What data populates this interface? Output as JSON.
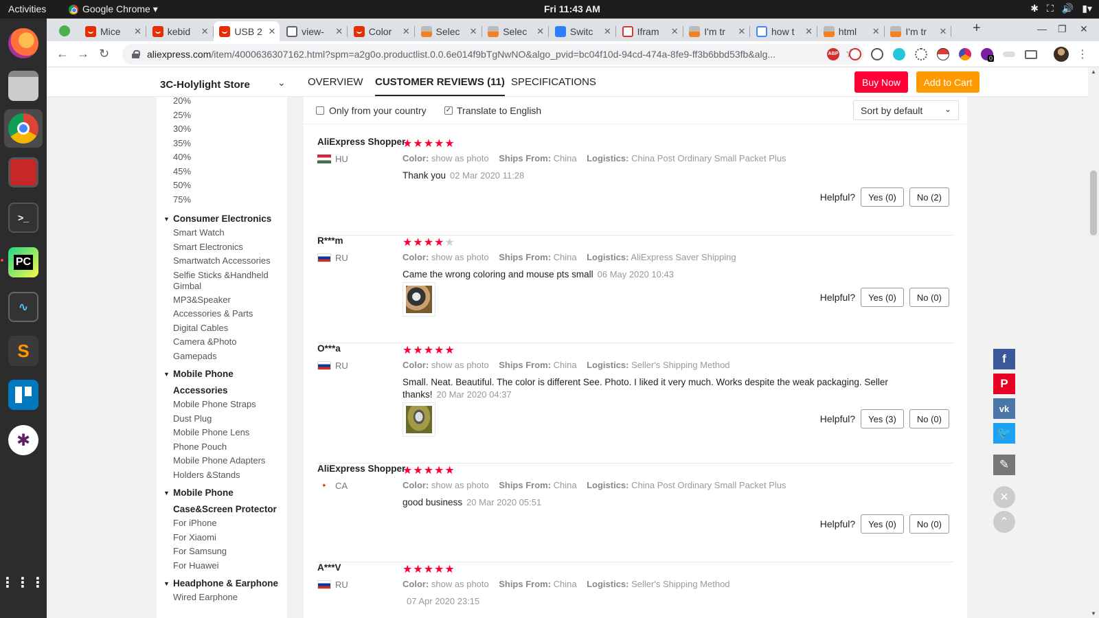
{
  "topbar": {
    "activities": "Activities",
    "app_name": "Google Chrome ▾",
    "clock": "Fri 11:43 AM"
  },
  "tabs": [
    {
      "label": "Mice",
      "icon": "aliexpress-icon"
    },
    {
      "label": "kebid",
      "icon": "aliexpress-icon"
    },
    {
      "label": "USB 2",
      "icon": "aliexpress-icon",
      "active": true
    },
    {
      "label": "view-",
      "icon": "globe-icon"
    },
    {
      "label": "Color",
      "icon": "aliexpress-icon"
    },
    {
      "label": "Selec",
      "icon": "stackoverflow-icon"
    },
    {
      "label": "Selec",
      "icon": "stackoverflow-icon"
    },
    {
      "label": "Switc",
      "icon": "tb-icon"
    },
    {
      "label": "Ifram",
      "icon": "iframe-icon"
    },
    {
      "label": "I'm tr",
      "icon": "stackoverflow-icon"
    },
    {
      "label": "how t",
      "icon": "google-icon"
    },
    {
      "label": "html",
      "icon": "stackoverflow-icon"
    },
    {
      "label": "I'm tr",
      "icon": "stackoverflow-icon"
    }
  ],
  "toolbar": {
    "url_host": "aliexpress.com",
    "url_path": "/item/4000636307162.html?spm=a2g0o.productlist.0.0.6e014f9bTgNwNO&algo_pvid=bc04f10d-94cd-474a-8fe9-ff3b6bbd53fb&alg...",
    "ext_badge": "0"
  },
  "header": {
    "store_name": "3C-Holylight Store",
    "tabs": [
      "OVERVIEW",
      "CUSTOMER REVIEWS (11)",
      "SPECIFICATIONS"
    ],
    "buy_now": "Buy Now",
    "add_to_cart": "Add to Cart",
    "colors": {
      "buy_now": "#ff0036",
      "add_to_cart": "#ff9900"
    }
  },
  "sidebar": {
    "percents": [
      "20%",
      "25%",
      "30%",
      "35%",
      "40%",
      "45%",
      "50%",
      "75%"
    ],
    "groups": [
      {
        "title": "Consumer Electronics",
        "items": [
          "Smart Watch",
          "Smart Electronics",
          "Smartwatch Accessories",
          "Selfie Sticks &Handheld Gimbal",
          "MP3&Speaker",
          "Accessories & Parts",
          "Digital Cables",
          "Camera &Photo",
          "Gamepads"
        ]
      },
      {
        "title": "Mobile Phone Accessories",
        "items": [
          "Mobile Phone Straps",
          "Dust Plug",
          "Mobile Phone Lens",
          "Phone Pouch",
          "Mobile Phone Adapters",
          "Holders &Stands"
        ]
      },
      {
        "title": "Mobile Phone Case&Screen Protector",
        "items": [
          "For iPhone",
          "For Xiaomi",
          "For Samsung",
          "For Huawei"
        ]
      },
      {
        "title": "Headphone & Earphone",
        "items": [
          "Wired Earphone"
        ]
      }
    ]
  },
  "filters": {
    "only_country": "Only from your country",
    "only_country_checked": false,
    "translate": "Translate to English",
    "translate_checked": true,
    "sort": "Sort by default"
  },
  "labels": {
    "color": "Color:",
    "ships_from": "Ships From:",
    "logistics": "Logistics:",
    "helpful": "Helpful?"
  },
  "reviews": [
    {
      "name": "AliExpress Shopper",
      "country": "HU",
      "flag": "flag-hu",
      "stars": 5,
      "color": "show as photo",
      "ships_from": "China",
      "logistics": "China Post Ordinary Small Packet Plus",
      "text": "Thank you",
      "date": "02 Mar 2020 11:28",
      "yes": "Yes (0)",
      "no": "No (2)"
    },
    {
      "name": "R***m",
      "country": "RU",
      "flag": "flag-ru",
      "stars": 4,
      "color": "show as photo",
      "ships_from": "China",
      "logistics": "AliExpress Saver Shipping",
      "text": "Came the wrong coloring and mouse pts small",
      "date": "06 May 2020 10:43",
      "yes": "Yes (0)",
      "no": "No (0)",
      "has_photo": true
    },
    {
      "name": "O***a",
      "country": "RU",
      "flag": "flag-ru",
      "stars": 5,
      "color": "show as photo",
      "ships_from": "China",
      "logistics": "Seller's Shipping Method",
      "text": "Small. Neat. Beautiful. The color is different See. Photo. I liked it very much. Works despite the weak packaging. Seller thanks!",
      "date": "20 Mar 2020 04:37",
      "yes": "Yes (3)",
      "no": "No (0)",
      "has_photo": true
    },
    {
      "name": "AliExpress Shopper",
      "country": "CA",
      "flag": "flag-ca",
      "stars": 5,
      "color": "show as photo",
      "ships_from": "China",
      "logistics": "China Post Ordinary Small Packet Plus",
      "text": "good business",
      "date": "20 Mar 2020 05:51",
      "yes": "Yes (0)",
      "no": "No (0)"
    },
    {
      "name": "A***V",
      "country": "RU",
      "flag": "flag-ru",
      "stars": 5,
      "color": "show as photo",
      "ships_from": "China",
      "logistics": "Seller's Shipping Method",
      "text": "",
      "date": "07 Apr 2020 23:15"
    }
  ],
  "social": [
    "facebook-icon",
    "pinterest-icon",
    "vk-icon",
    "twitter-icon",
    "edit-icon"
  ],
  "social_colors": {
    "facebook": "#3b5998",
    "pinterest": "#e60023",
    "vk": "#4a76a8",
    "twitter": "#1da1f2",
    "edit": "#777777"
  }
}
